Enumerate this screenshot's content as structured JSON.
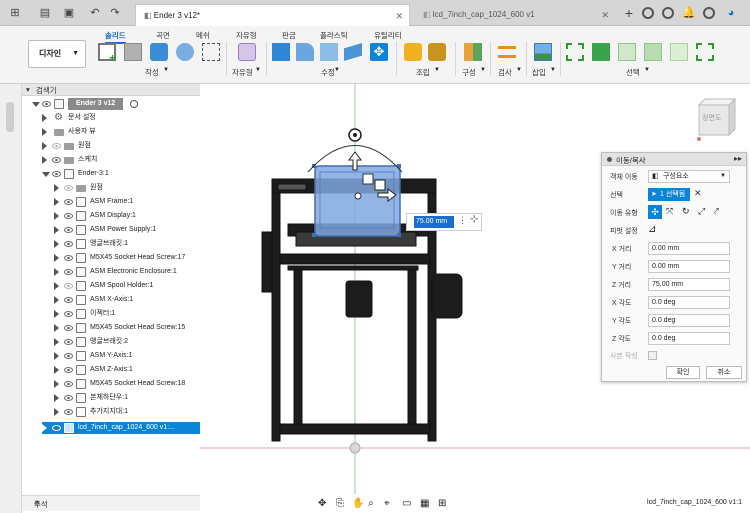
{
  "tabs": [
    {
      "label": "Ender 3 v12*",
      "active": true
    },
    {
      "label": "lcd_7inch_cap_1024_600 v1",
      "active": false
    }
  ],
  "toolbar": {
    "design_label": "디자인",
    "workspace_tabs": [
      "솔리드",
      "곡면",
      "메쉬",
      "자유형",
      "판금",
      "플라스틱",
      "유틸리티"
    ],
    "groups": [
      "작성",
      "자유형",
      "수정",
      "조립",
      "구성",
      "검사",
      "삽입",
      "선택"
    ]
  },
  "browser": {
    "title": "검색기",
    "root_label": "Ender 3 v12",
    "items": [
      "문서 설정",
      "사용자 뷰",
      "원점",
      "스케치",
      "Ender-3:1",
      "원점",
      "ASM Frame:1",
      "ASM Display:1",
      "ASM Power Supply:1",
      "앵글브래킷:1",
      "M5X45 Socket Head Screw:17",
      "ASM Electronic Enclosure:1",
      "ASM Spool Holder:1",
      "ASM X-Axis:1",
      "이젝터:1",
      "M5X45 Socket Head Screw:15",
      "앵글브래킷:2",
      "ASM Y-Axis:1",
      "ASM Z-Axis:1",
      "M5X45 Socket Head Screw:18",
      "본체하단우:1",
      "추가지지대:1",
      "lcd_7inch_cap_1024_600 v1:..."
    ]
  },
  "viewcube_label": "정면도",
  "value_input": "75.00 mm",
  "dialog": {
    "title": "이동/복사",
    "object_move_label": "객체 이동",
    "object_move_value": "구성요소",
    "selection_label": "선택",
    "selection_value": "1 선택됨",
    "move_type_label": "이동 유형",
    "pivot_label": "피벗 설정",
    "fields": [
      {
        "label": "X 거리",
        "value": "0.00 mm"
      },
      {
        "label": "Y 거리",
        "value": "0.00 mm"
      },
      {
        "label": "Z 거리",
        "value": "75.00 mm"
      },
      {
        "label": "X 각도",
        "value": "0.0 deg"
      },
      {
        "label": "Y 각도",
        "value": "0.0 deg"
      },
      {
        "label": "Z 각도",
        "value": "0.0 deg"
      }
    ],
    "copy_label": "사본 작성",
    "ok_label": "확인",
    "cancel_label": "취소"
  },
  "comment_label": "주석",
  "status_label": "lcd_7inch_cap_1024_600 v1:1",
  "colors": {
    "accent": "#0a84d6",
    "selection_blue": "#7fa8e0",
    "grid_red": "#e57373",
    "grid_green": "#81c784"
  }
}
